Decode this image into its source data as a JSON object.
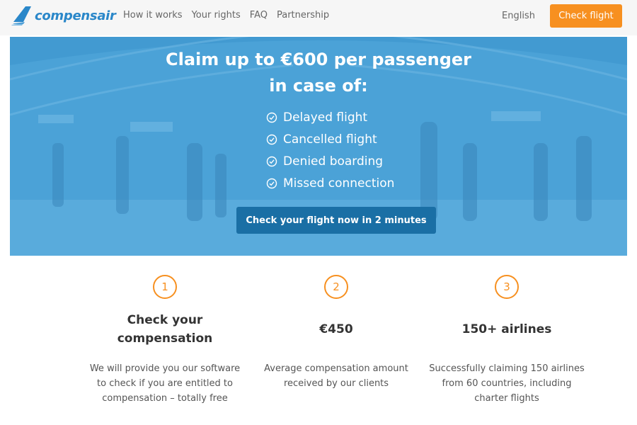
{
  "brand": {
    "name": "compensair"
  },
  "nav": {
    "links": [
      "How it works",
      "Your rights",
      "FAQ",
      "Partnership"
    ],
    "language": "English",
    "cta": "Check flight"
  },
  "hero": {
    "title_line1": "Claim up to €600 per passenger",
    "title_line2": "in case of:",
    "items": [
      "Delayed flight",
      "Cancelled flight",
      "Denied boarding",
      "Missed connection"
    ],
    "cta": "Check your flight now in 2 minutes"
  },
  "features": [
    {
      "number": "1",
      "title": "Check your compensation",
      "description": "We will provide you our software to check if you are entitled to compensation – totally free"
    },
    {
      "number": "2",
      "title": "€450",
      "description": "Average compensation amount received by our clients"
    },
    {
      "number": "3",
      "title": "150+ airlines",
      "description": "Successfully claiming 150 airlines from 60 countries, including charter flights"
    }
  ],
  "colors": {
    "accent": "#f79020",
    "brand": "#2a87c9",
    "hero_overlay": "#4aa1d6",
    "hero_button": "#1a6fa5"
  },
  "icons": {
    "check": "check-circle-icon",
    "logo": "wing-logo-icon"
  }
}
